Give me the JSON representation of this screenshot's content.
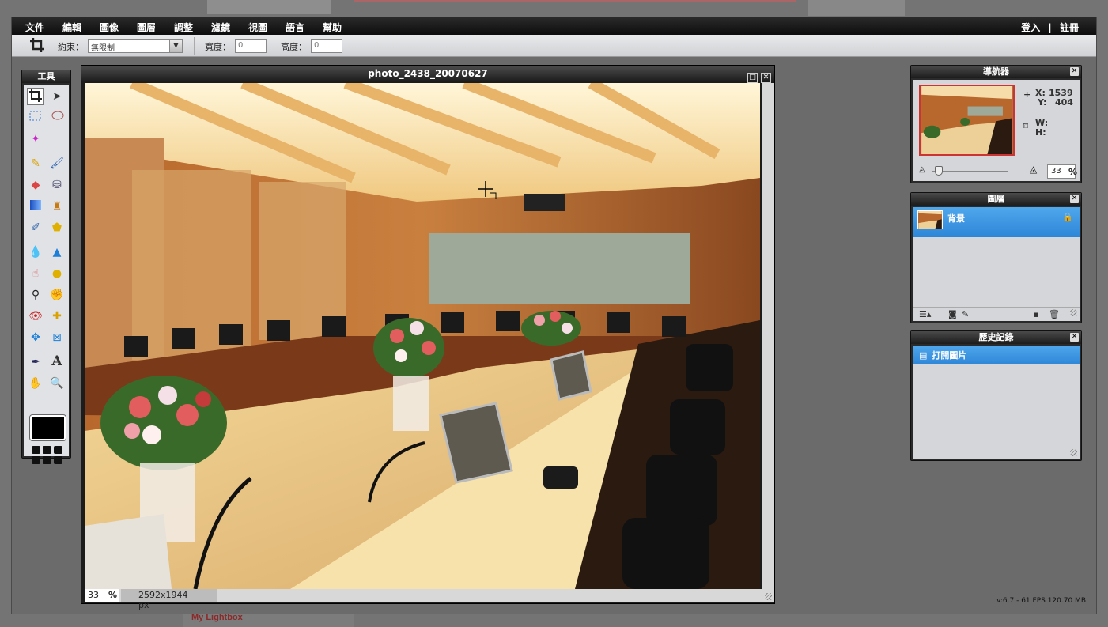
{
  "background": {
    "lightbox_link": "My Lightbox"
  },
  "menubar": {
    "items": [
      "文件",
      "編輯",
      "圖像",
      "圖層",
      "調整",
      "濾鏡",
      "視圖",
      "語言",
      "幫助"
    ],
    "login": "登入",
    "divider": "|",
    "register": "註冊"
  },
  "options": {
    "constraint_label": "約束：",
    "constraint_value": "無限制",
    "width_label": "寬度：",
    "width_value": "0",
    "height_label": "高度：",
    "height_value": "0"
  },
  "tools": {
    "title": "工具"
  },
  "document": {
    "title": "photo_2438_20070627",
    "zoom": "33",
    "zoom_unit": "%",
    "dimensions": "2592x1944 px"
  },
  "navigator": {
    "title": "導航器",
    "x_label": "X:",
    "x_value": "1539",
    "y_label": "Y:",
    "y_value": "404",
    "w_label": "W:",
    "h_label": "H:",
    "zoom_value": "33",
    "zoom_unit": "%"
  },
  "layers": {
    "title": "圖層",
    "items": [
      {
        "name": "背景",
        "locked": true
      }
    ]
  },
  "history": {
    "title": "歷史記錄",
    "items": [
      "打開圖片"
    ]
  },
  "status": {
    "fps": "v:6.7 - 61 FPS 120.70 MB"
  },
  "colors": {
    "accent": "#3d98e6",
    "menubar": "#141414",
    "panel_body": "#d4d6d9"
  }
}
